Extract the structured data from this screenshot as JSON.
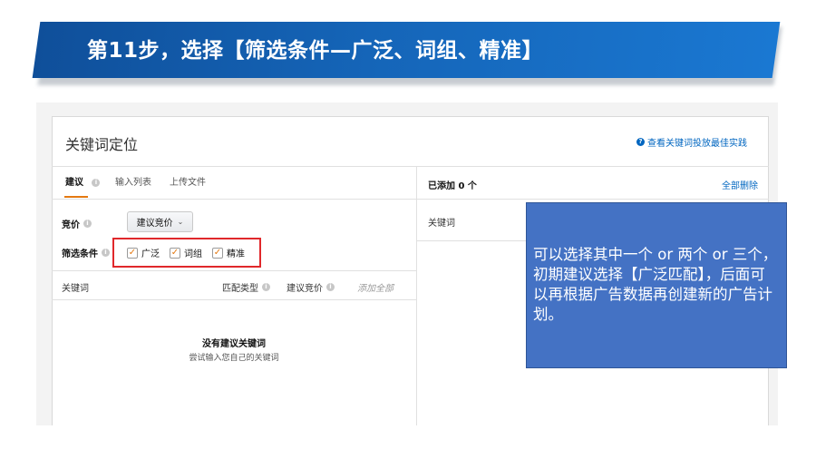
{
  "slide": {
    "title": "第11步，选择【筛选条件—广泛、词组、精准】"
  },
  "panel": {
    "title": "关键词定位",
    "help_link": "查看关键词投放最佳实践",
    "help_icon": "?",
    "info_icon": "i"
  },
  "tabs": [
    {
      "label": "建议",
      "active": true
    },
    {
      "label": "输入列表",
      "active": false
    },
    {
      "label": "上传文件",
      "active": false
    }
  ],
  "right_panel": {
    "added": "已添加 0 个",
    "delete_all": "全部删除",
    "keyword_header": "关键词"
  },
  "bid": {
    "label": "竞价",
    "dropdown_value": "建议竞价",
    "chevron": "⌄"
  },
  "filter": {
    "label": "筛选条件",
    "options": [
      {
        "label": "广泛",
        "checked": true
      },
      {
        "label": "词组",
        "checked": true
      },
      {
        "label": "精准",
        "checked": true
      }
    ],
    "check_glyph": "✓"
  },
  "table": {
    "col_keyword": "关键词",
    "col_match": "匹配类型",
    "col_bid": "建议竞价",
    "col_add_all": "添加全部",
    "empty_title": "没有建议关键词",
    "empty_sub": "尝试输入您自己的关键词"
  },
  "callout": {
    "text": "可以选择其中一个 or 两个 or 三个，初期建议选择【广泛匹配】，后面可以再根据广告数据再创建新的广告计划。"
  },
  "colors": {
    "banner": "#1565b8",
    "accent_orange": "#e47911",
    "link_blue": "#0066c0",
    "highlight_red": "#e0282b",
    "callout_blue": "#4472c4"
  }
}
